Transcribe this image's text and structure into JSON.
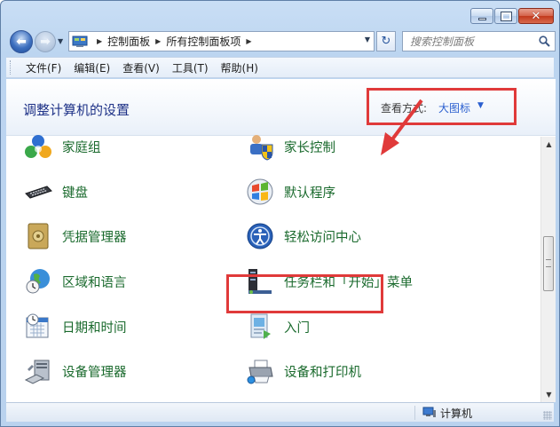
{
  "nav": {
    "breadcrumbs": [
      "控制面板",
      "所有控制面板项"
    ],
    "search_placeholder": "搜索控制面板"
  },
  "menu": [
    "文件(F)",
    "编辑(E)",
    "查看(V)",
    "工具(T)",
    "帮助(H)"
  ],
  "header": {
    "title": "调整计算机的设置",
    "view_label": "查看方式:",
    "view_value": "大图标"
  },
  "items": [
    {
      "label": "家庭组",
      "icon": "homegroup-icon"
    },
    {
      "label": "家长控制",
      "icon": "parental-controls-icon"
    },
    {
      "label": "键盘",
      "icon": "keyboard-icon"
    },
    {
      "label": "默认程序",
      "icon": "default-programs-icon"
    },
    {
      "label": "凭据管理器",
      "icon": "credential-manager-icon"
    },
    {
      "label": "轻松访问中心",
      "icon": "ease-of-access-icon"
    },
    {
      "label": "区域和语言",
      "icon": "region-language-icon"
    },
    {
      "label": "任务栏和「开始」菜单",
      "icon": "taskbar-start-menu-icon"
    },
    {
      "label": "日期和时间",
      "icon": "date-time-icon"
    },
    {
      "label": "入门",
      "icon": "getting-started-icon"
    },
    {
      "label": "设备管理器",
      "icon": "device-manager-icon"
    },
    {
      "label": "设备和打印机",
      "icon": "devices-printers-icon"
    }
  ],
  "status": {
    "computer_label": "计算机"
  },
  "colors": {
    "accent_red": "#e03a3a",
    "link_green": "#1a6a2d",
    "title_blue": "#1e3287"
  }
}
